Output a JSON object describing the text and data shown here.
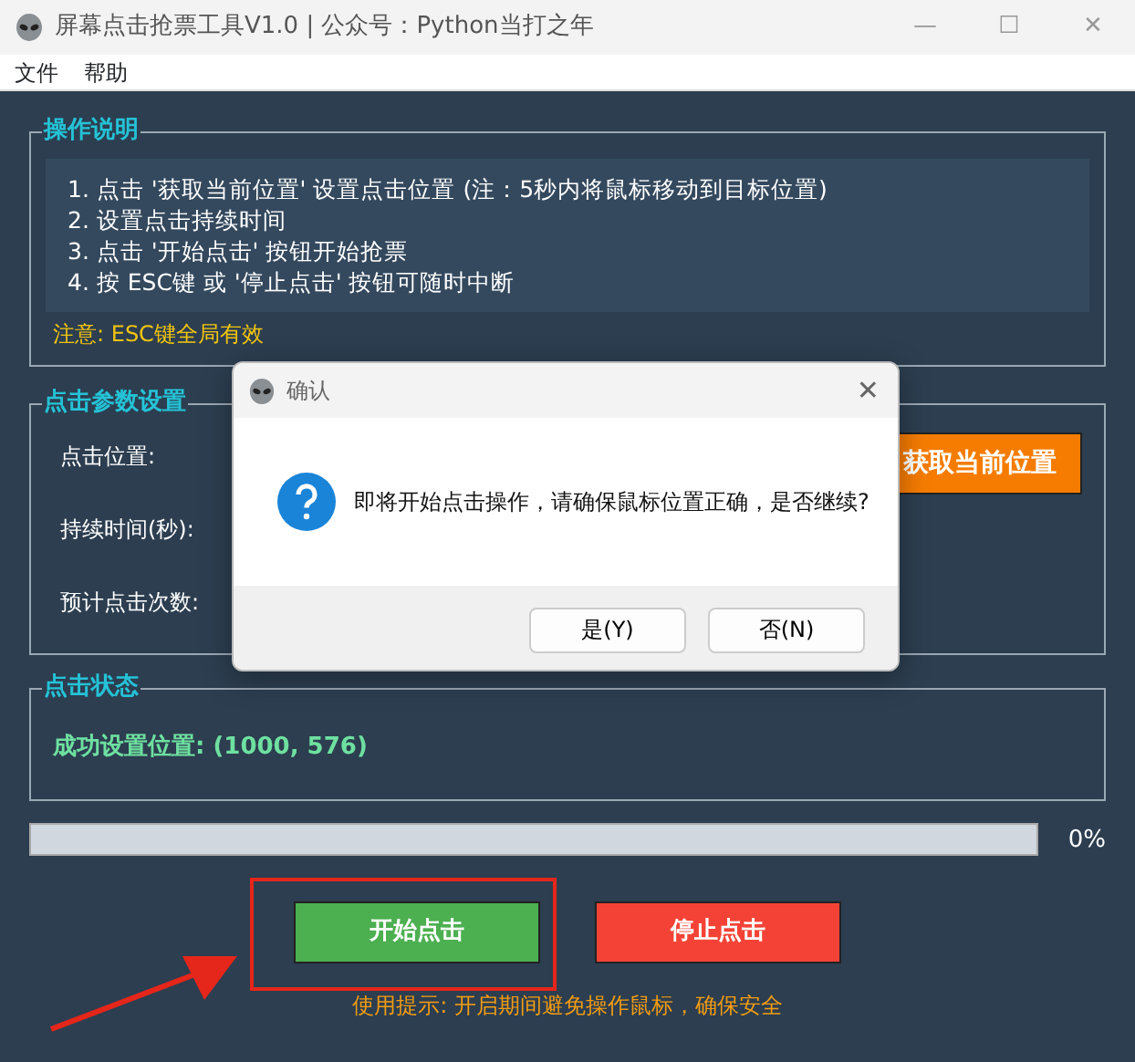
{
  "window": {
    "title": "屏幕点击抢票工具V1.0 | 公众号：Python当打之年",
    "controls": [
      "—",
      "☐",
      "✕"
    ]
  },
  "menu": [
    "文件",
    "帮助"
  ],
  "instructions": {
    "title": "操作说明",
    "lines": [
      "1. 点击 '获取当前位置' 设置点击位置 (注：5秒内将鼠标移动到目标位置)",
      "2. 设置点击持续时间",
      "3. 点击 '开始点击' 按钮开始抢票",
      "4. 按 ESC键 或 '停止点击' 按钮可随时中断"
    ],
    "note": "注意: ESC键全局有效"
  },
  "params": {
    "title": "点击参数设置",
    "labels": [
      "点击位置:",
      "持续时间(秒):",
      "预计点击次数:"
    ],
    "get_position_button": "获取当前位置"
  },
  "status": {
    "title": "点击状态",
    "message": "成功设置位置: (1000, 576)"
  },
  "progress": {
    "level": 0,
    "reading": "0%"
  },
  "buttons": [
    {
      "kind": "start",
      "label": "开始点击"
    },
    {
      "kind": "stop",
      "label": "停止点击"
    }
  ],
  "hint": "使用提示: 开启期间避免操作鼠标，确保安全",
  "dialog": {
    "title": "确认",
    "close": "✕",
    "message": "即将开始点击操作，请确保鼠标位置正确，是否继续?",
    "buttons": [
      "是(Y)",
      "否(N)"
    ]
  }
}
